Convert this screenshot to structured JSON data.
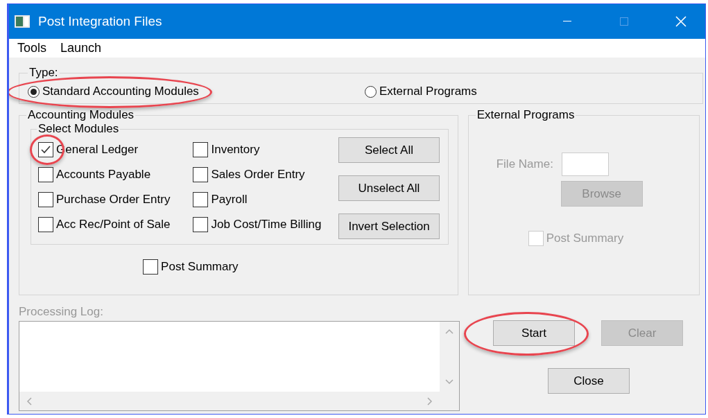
{
  "window": {
    "title": "Post Integration Files"
  },
  "menu": [
    {
      "label": "Tools"
    },
    {
      "label": "Launch"
    }
  ],
  "type_group": {
    "title": "Type:",
    "options": [
      {
        "label": "Standard Accounting Modules",
        "selected": true,
        "annotated": true
      },
      {
        "label": "External Programs",
        "selected": false,
        "annotated": false
      }
    ]
  },
  "accounting_modules": {
    "title": "Accounting Modules",
    "select_modules": {
      "title": "Select Modules",
      "columns": [
        [
          {
            "label": "General Ledger",
            "checked": true,
            "annotated": true
          },
          {
            "label": "Accounts Payable",
            "checked": false,
            "annotated": false
          },
          {
            "label": "Purchase Order Entry",
            "checked": false,
            "annotated": false
          },
          {
            "label": "Acc Rec/Point of Sale",
            "checked": false,
            "annotated": false
          }
        ],
        [
          {
            "label": "Inventory",
            "checked": false,
            "annotated": false
          },
          {
            "label": "Sales Order Entry",
            "checked": false,
            "annotated": false
          },
          {
            "label": "Payroll",
            "checked": false,
            "annotated": false
          },
          {
            "label": "Job Cost/Time Billing",
            "checked": false,
            "annotated": false
          }
        ]
      ],
      "buttons": [
        {
          "label": "Select All"
        },
        {
          "label": "Unselect All"
        },
        {
          "label": "Invert Selection"
        }
      ]
    },
    "post_summary": {
      "label": "Post Summary",
      "checked": false
    }
  },
  "external_programs": {
    "title": "External Programs",
    "disabled": true,
    "file_name": {
      "label": "File Name:"
    },
    "browse_button": {
      "label": "Browse"
    },
    "post_summary": {
      "label": "Post Summary",
      "checked": false
    }
  },
  "processing_log": {
    "label": "Processing Log:",
    "disabled": true
  },
  "actions": [
    {
      "label": "Start",
      "disabled": false,
      "annotated": true
    },
    {
      "label": "Clear",
      "disabled": true,
      "annotated": false
    },
    {
      "label": "Close",
      "disabled": false,
      "annotated": false
    }
  ]
}
